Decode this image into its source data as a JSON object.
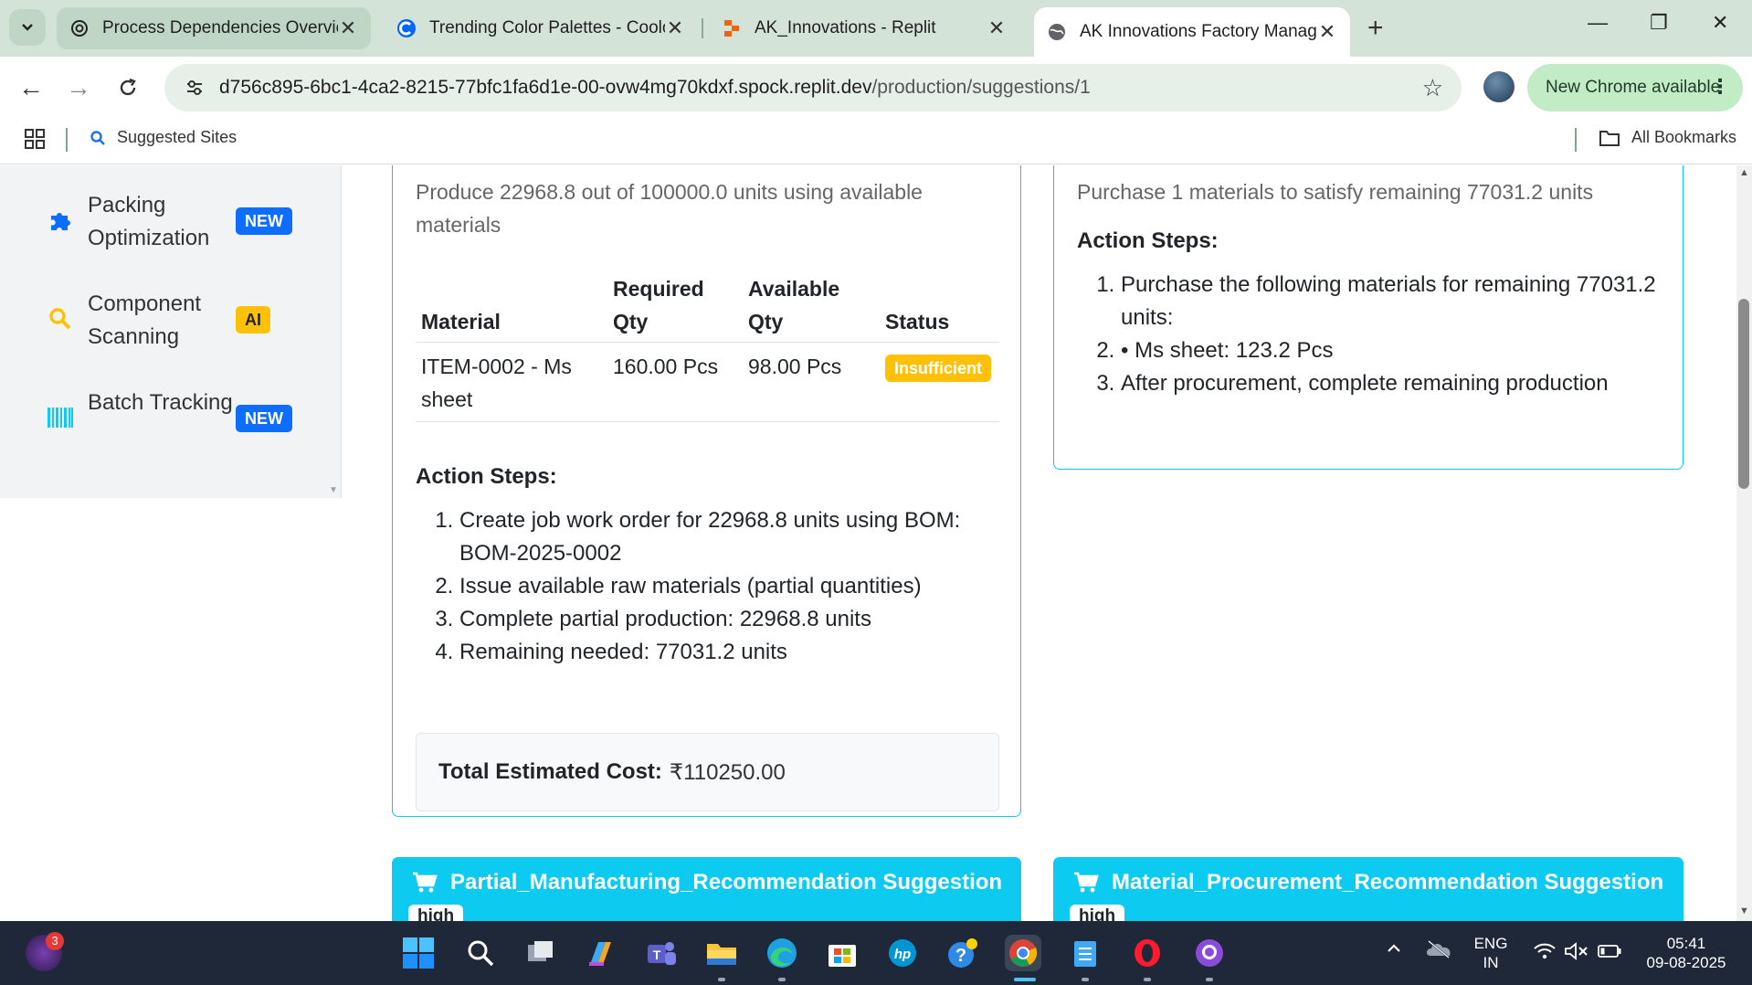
{
  "browser": {
    "tabs": [
      {
        "title": "Process Dependencies Overview",
        "state": "hover"
      },
      {
        "title": "Trending Color Palettes - Coolors",
        "state": "normal"
      },
      {
        "title": "AK_Innovations - Replit",
        "state": "normal"
      },
      {
        "title": "AK Innovations Factory Management",
        "state": "active"
      }
    ],
    "url_host": "d756c895-6bc1-4ca2-8215-77bfc1fa6d1e-00-ovw4mg70kdxf.spock.replit.dev",
    "url_path": "/production/suggestions/1",
    "update_label": "New Chrome available",
    "bookmarks": {
      "suggested": "Suggested Sites",
      "all": "All Bookmarks"
    }
  },
  "sidebar": {
    "items": [
      {
        "label": "Packing Optimization",
        "badge": "NEW",
        "icon": "puzzle-icon"
      },
      {
        "label": "Component Scanning",
        "badge": "AI",
        "icon": "search-icon"
      },
      {
        "label": "Batch Tracking",
        "badge": "NEW",
        "icon": "barcode-icon"
      }
    ]
  },
  "left_card": {
    "summary": "Produce 22968.8 out of 100000.0 units using available materials",
    "table": {
      "headers": [
        "Material",
        "Required Qty",
        "Available Qty",
        "Status"
      ],
      "rows": [
        {
          "material": "ITEM-0002 - Ms sheet",
          "required": "160.00 Pcs",
          "available": "98.00 Pcs",
          "status": "Insufficient"
        }
      ]
    },
    "steps_heading": "Action Steps:",
    "steps": [
      "Create job work order for 22968.8 units using BOM: BOM-2025-0002",
      "Issue available raw materials (partial quantities)",
      "Complete partial production: 22968.8 units",
      "Remaining needed: 77031.2 units"
    ],
    "total_label": "Total Estimated Cost:",
    "total_value": "₹110250.00"
  },
  "right_card": {
    "summary": "Purchase 1 materials to satisfy remaining 77031.2 units",
    "steps_heading": "Action Steps:",
    "steps": [
      "Purchase the following materials for remaining 77031.2 units:",
      "• Ms sheet: 123.2 Pcs",
      "After procurement, complete remaining production"
    ]
  },
  "suggestion_headers": [
    {
      "title": "Partial_Manufacturing_Recommendation Suggestion",
      "priority": "high"
    },
    {
      "title": "Material_Procurement_Recommendation Suggestion",
      "priority": "high"
    }
  ],
  "taskbar": {
    "notification_count": "3",
    "lang_line1": "ENG",
    "lang_line2": "IN",
    "time": "05:41",
    "date": "09-08-2025"
  },
  "colors": {
    "info": "#0dcaf0",
    "primary": "#0d6efd",
    "warning": "#ffc107",
    "tabstrip": "#d3e3d8"
  }
}
